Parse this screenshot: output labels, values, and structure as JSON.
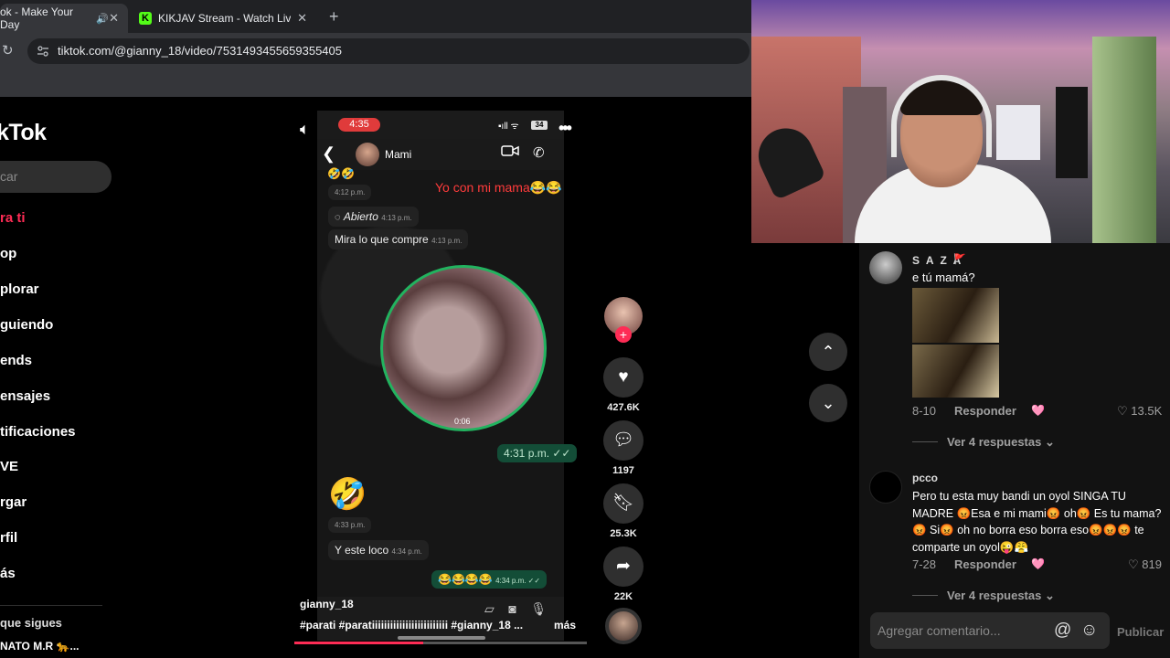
{
  "browser": {
    "tabs": [
      {
        "title": "ok - Make Your Day",
        "audio": "🔊",
        "close": "✕"
      },
      {
        "title": "KIKJAV Stream - Watch Live on",
        "close": "✕"
      }
    ],
    "new_tab": "+",
    "reload": "↻",
    "url": "tiktok.com/@gianny_18/video/7531493455659355405"
  },
  "sidebar": {
    "logo": "kTok",
    "search_placeholder": "car",
    "items": [
      {
        "label": "ra ti"
      },
      {
        "label": "op"
      },
      {
        "label": "plorar"
      },
      {
        "label": "guiendo"
      },
      {
        "label": "ends"
      },
      {
        "label": "ensajes"
      },
      {
        "label": "tificaciones"
      },
      {
        "label": "VE"
      },
      {
        "label": "rgar"
      },
      {
        "label": "rfil"
      },
      {
        "label": "ás"
      }
    ],
    "following_title": "que sigues",
    "following_user": "NATO M.R 🐆..."
  },
  "video": {
    "status_time": "4:35",
    "signal": "▪ıll ᯤ",
    "battery": "34",
    "chat_name": "Mami",
    "messages": {
      "ts1": "4:12 p.m.",
      "overlay": "Yo con mi mama😂😂",
      "abierto": "Abierto",
      "abierto_ts": "4:13 p.m.",
      "mira": "Mira lo que compre",
      "mira_ts": "4:13 p.m.",
      "circle_duration": "0:06",
      "out_ts1": "4:31 p.m. ✓✓",
      "laugh": "🤣",
      "ts_433": "4:33 p.m.",
      "y_este": "Y este loco",
      "y_este_ts": "4:34 p.m.",
      "out_emojis": "😂😂😂😂",
      "out_emojis_ts": "4:34 p.m. ✓✓"
    },
    "caption_user": "gianny_18",
    "caption_tags": "#parati  #paratiiiiiiiiiiiiiiiiiiiiiiiii  #gianny_18  ...",
    "caption_more": "más",
    "progress": 0.44
  },
  "actions": {
    "follow": "+",
    "likes": "427.6K",
    "comments": "1197",
    "saves": "25.3K",
    "shares": "22K"
  },
  "nav_arrows": {
    "up": "⌃",
    "down": "⌄"
  },
  "comments_panel": {
    "comment1": {
      "user": "S A Z A",
      "flag": "🚩",
      "text": "e tú mamá?",
      "date": "8-10",
      "reply": "Responder",
      "likes": "13.5K",
      "view_more": "Ver 4 respuestas"
    },
    "comment2": {
      "user": "pcco",
      "text": "Pero tu esta muy bandi un oyol SINGA TU MADRE 😡Esa e mi mami😡 oh😡 Es tu mama? 😡 Si😡 oh no borra eso borra eso😡😡😡 te comparte un oyol😜😤",
      "date": "7-28",
      "reply": "Responder",
      "likes": "819",
      "view_more": "Ver 4 respuestas"
    },
    "input_placeholder": "Agregar comentario...",
    "publish": "Publicar"
  }
}
